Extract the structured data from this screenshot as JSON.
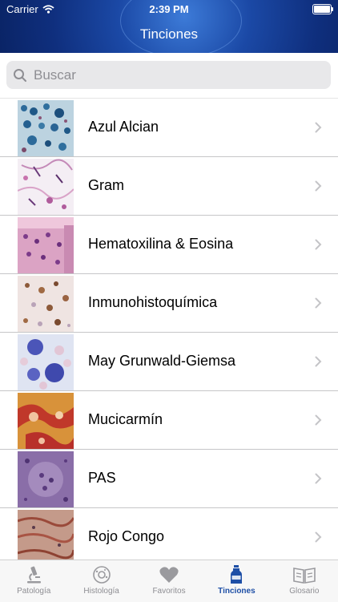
{
  "status": {
    "carrier": "Carrier",
    "time": "2:39 PM"
  },
  "nav": {
    "title": "Tinciones"
  },
  "search": {
    "placeholder": "Buscar"
  },
  "items": [
    {
      "label": "Azul Alcian"
    },
    {
      "label": "Gram"
    },
    {
      "label": "Hematoxilina & Eosina"
    },
    {
      "label": "Inmunohistoquímica"
    },
    {
      "label": "May Grunwald-Giemsa"
    },
    {
      "label": "Mucicarmín"
    },
    {
      "label": "PAS"
    },
    {
      "label": "Rojo Congo"
    }
  ],
  "tabs": [
    {
      "label": "Patología",
      "icon": "microscope-icon"
    },
    {
      "label": "Histología",
      "icon": "cell-icon"
    },
    {
      "label": "Favoritos",
      "icon": "heart-icon"
    },
    {
      "label": "Tinciones",
      "icon": "bottle-icon",
      "active": true
    },
    {
      "label": "Glosario",
      "icon": "book-icon"
    }
  ],
  "colors": {
    "accent": "#1e4fa6",
    "header": "#0f2f7e"
  }
}
